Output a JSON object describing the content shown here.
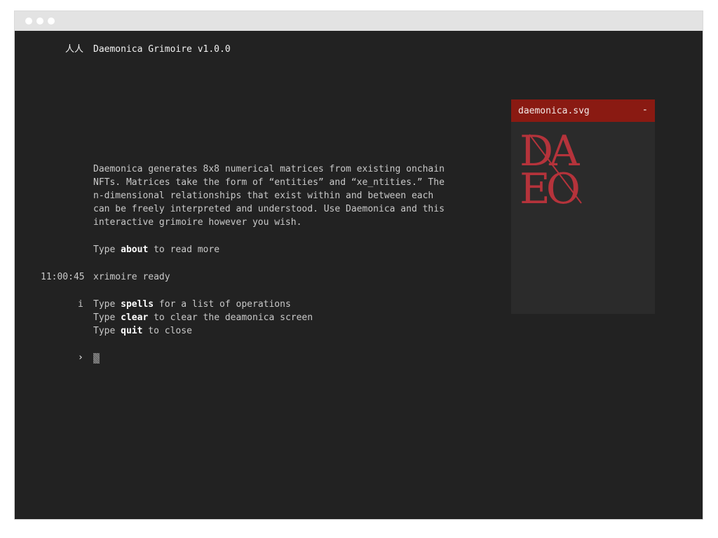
{
  "header": {
    "glyph": "人人",
    "title": "Daemonica Grimoire v1.0.0"
  },
  "intro": {
    "lines": [
      "Daemonica generates 8x8 numerical matrices from existing onchain",
      "NFTs. Matrices take the form of “entities” and “xe_ntities.” The",
      "n-dimensional relationships that exist within and between each",
      "can be freely interpreted and understood. Use Daemonica and this",
      "interactive grimoire however you wish."
    ],
    "about": {
      "pre": "Type ",
      "cmd": "about",
      "post": " to read more"
    }
  },
  "log": {
    "timestamp": "11:00:45",
    "message": "xrimoire ready"
  },
  "help": {
    "marker": "i",
    "lines": [
      {
        "pre": "Type ",
        "cmd": "spells",
        "post": " for a list of operations"
      },
      {
        "pre": "Type ",
        "cmd": "clear",
        "post": " to clear the deamonica screen"
      },
      {
        "pre": "Type ",
        "cmd": "quit",
        "post": " to close"
      }
    ]
  },
  "prompt": {
    "symbol": "›"
  },
  "panel": {
    "title": "daemonica.svg",
    "minimize": "-",
    "logo": {
      "top": "DA",
      "bottom": "EO",
      "color": "#b5333b"
    }
  },
  "colors": {
    "background": "#222222",
    "accent": "#8a1a12",
    "text": "#c9c9c9"
  }
}
